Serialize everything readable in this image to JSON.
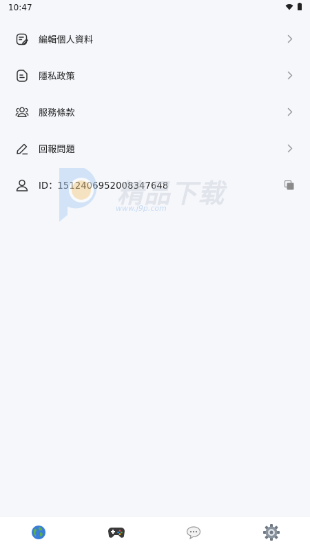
{
  "status_bar": {
    "time": "10:47"
  },
  "menu": {
    "items": [
      {
        "label": "編輯個人資料",
        "icon": "edit-profile-icon"
      },
      {
        "label": "隱私政策",
        "icon": "privacy-document-icon"
      },
      {
        "label": "服務條款",
        "icon": "users-icon"
      },
      {
        "label": "回報問題",
        "icon": "pencil-icon"
      }
    ],
    "id_row": {
      "label": "ID：1512406952008347648",
      "icon": "person-icon",
      "action_icon": "copy-icon"
    }
  },
  "watermark": {
    "title": "精品下载",
    "url": "www.j9p.com"
  },
  "bottom_nav": {
    "items": [
      {
        "icon": "globe-icon"
      },
      {
        "icon": "gamepad-icon"
      },
      {
        "icon": "chat-bubble-icon"
      },
      {
        "icon": "gear-icon"
      }
    ]
  },
  "colors": {
    "background": "#f5f7fb",
    "icon_stroke": "#333333",
    "chevron": "#9a9a9a"
  }
}
